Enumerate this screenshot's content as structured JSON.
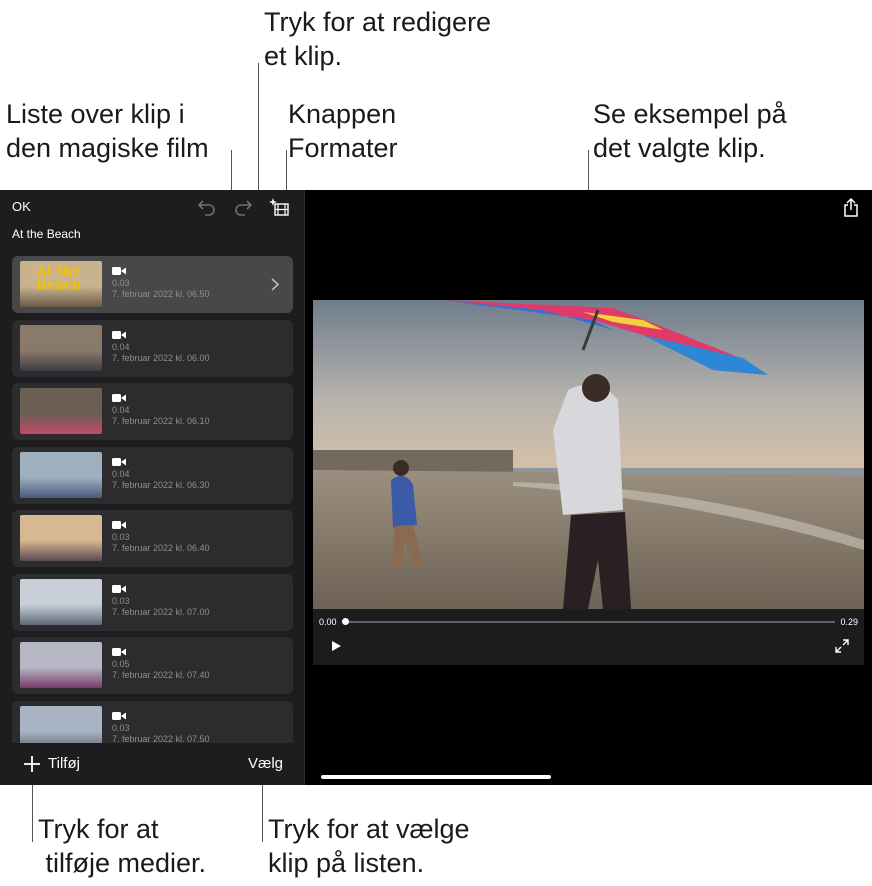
{
  "callouts": {
    "edit_clip": "Tryk for at redigere\net klip.",
    "clip_list": "Liste over klip i\nden magiske film",
    "formats_button": "Knappen\nFormater",
    "preview": "Se eksempel på\ndet valgte klip.",
    "add_media": "Tryk for at\n tilføje medier.",
    "select_clips": "Tryk for at vælge\nklip på listen."
  },
  "toolbar": {
    "ok_label": "OK",
    "undo_icon": "undo-icon",
    "redo_icon": "redo-icon",
    "formats_icon": "sparkle-film-icon",
    "share_icon": "share-icon"
  },
  "project": {
    "title": "At the Beach"
  },
  "clips": [
    {
      "duration": "0.03",
      "date": "7. februar 2022 kl. 06.50",
      "thumb_text": "At the\nBeach",
      "selected": true
    },
    {
      "duration": "0.04",
      "date": "7. februar 2022 kl. 06.00"
    },
    {
      "duration": "0.04",
      "date": "7. februar 2022 kl. 06.10"
    },
    {
      "duration": "0.04",
      "date": "7. februar 2022 kl. 06.30"
    },
    {
      "duration": "0.03",
      "date": "7. februar 2022 kl. 06.40"
    },
    {
      "duration": "0.03",
      "date": "7. februar 2022 kl. 07.00"
    },
    {
      "duration": "0.05",
      "date": "7. februar 2022 kl. 07.40"
    },
    {
      "duration": "0.03",
      "date": "7. februar 2022 kl. 07.50"
    }
  ],
  "bottombar": {
    "add_label": "Tilføj",
    "select_label": "Vælg"
  },
  "player": {
    "time_start": "0.00",
    "time_end": "0.29",
    "progress": 0.0
  },
  "colors": {
    "accent_kite": "#e03a6a",
    "background": "#000000",
    "sidebar": "#1d1d1f"
  }
}
